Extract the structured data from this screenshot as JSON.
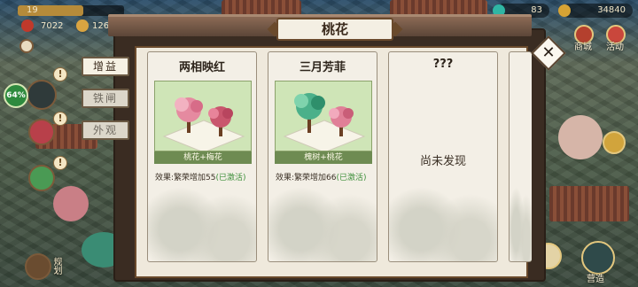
{
  "hud": {
    "level": "19",
    "level_progress": 0.62,
    "stat1": "7022",
    "stat2": "126",
    "gems": "83",
    "coins": "34840"
  },
  "side": {
    "percent_badge": "64%",
    "excl": "!"
  },
  "panel": {
    "title": "桃花",
    "close_symbol": "✕"
  },
  "tabs": [
    {
      "label": "增益",
      "active": true
    },
    {
      "label": "铁闸",
      "active": false
    },
    {
      "label": "外观",
      "active": false
    }
  ],
  "cards": [
    {
      "title": "两相映红",
      "caption": "桃花+梅花",
      "effect_prefix": "效果:繁荣增加55",
      "effect_status": "(已激活)",
      "discovered": true
    },
    {
      "title": "三月芳菲",
      "caption": "槐树+桃花",
      "effect_prefix": "效果:繁荣增加66",
      "effect_status": "(已激活)",
      "discovered": true
    },
    {
      "title": "???",
      "undiscovered_text": "尚未发现",
      "discovered": false
    }
  ],
  "right_menu": {
    "shop": "商城",
    "event": "活动",
    "bottom": "营造"
  },
  "bottom_left": {
    "plan": "规划"
  },
  "colors": {
    "activated_green": "#3d8f3a",
    "panel_frame": "#3a2c22",
    "parchment": "#efe9dc"
  }
}
